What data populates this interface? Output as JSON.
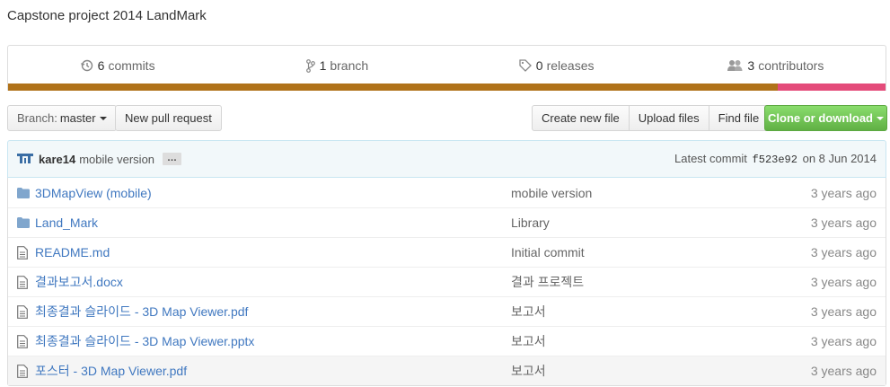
{
  "repo": {
    "description": "Capstone project 2014 LandMark"
  },
  "summary": {
    "commits": {
      "count": "6",
      "label": "commits",
      "icon": "history-icon"
    },
    "branches": {
      "count": "1",
      "label": "branch",
      "icon": "branch-icon"
    },
    "releases": {
      "count": "0",
      "label": "releases",
      "icon": "tag-icon"
    },
    "contributors": {
      "count": "3",
      "label": "contributors",
      "icon": "people-icon"
    },
    "language_bar": [
      {
        "color": "#b07219",
        "share": 0.877
      },
      {
        "color": "#e44b7a",
        "share": 0.123
      }
    ]
  },
  "toolbar": {
    "branch_prefix": "Branch:",
    "branch_name": "master",
    "new_pull_request": "New pull request",
    "create_new_file": "Create new file",
    "upload_files": "Upload files",
    "find_file": "Find file",
    "clone_or_download": "Clone or download"
  },
  "latest_commit": {
    "author": "kare14",
    "message": "mobile version",
    "ellipsis": "…",
    "prefix": "Latest commit",
    "sha": "f523e92",
    "date": "on 8 Jun 2014"
  },
  "files": [
    {
      "type": "folder",
      "name": "3DMapView (mobile)",
      "message": "mobile version",
      "age": "3 years ago"
    },
    {
      "type": "folder",
      "name": "Land_Mark",
      "message": "Library",
      "age": "3 years ago"
    },
    {
      "type": "file",
      "name": "README.md",
      "message": "Initial commit",
      "age": "3 years ago"
    },
    {
      "type": "file",
      "name": "결과보고서.docx",
      "message": "결과 프로젝트",
      "age": "3 years ago"
    },
    {
      "type": "file",
      "name": "최종결과 슬라이드 - 3D Map Viewer.pdf",
      "message": "보고서",
      "age": "3 years ago"
    },
    {
      "type": "file",
      "name": "최종결과 슬라이드 - 3D Map Viewer.pptx",
      "message": "보고서",
      "age": "3 years ago"
    },
    {
      "type": "file",
      "name": "포스터 - 3D Map Viewer.pdf",
      "message": "보고서",
      "age": "3 years ago"
    }
  ],
  "colors": {
    "link": "#4078c0",
    "folder_icon": "#80a6cd",
    "green_button": "#60b044"
  }
}
